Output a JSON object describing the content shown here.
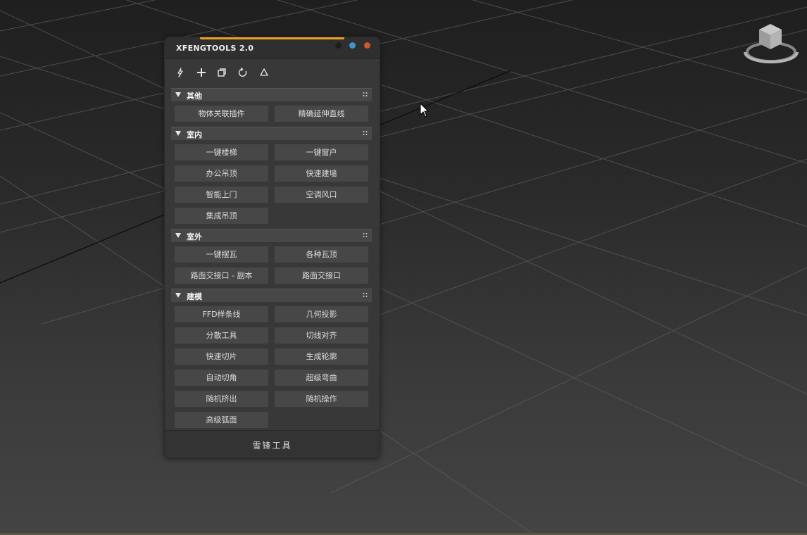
{
  "panel": {
    "title": "XFENGTOOLS  2.0",
    "accent_color": "#f0a020",
    "window_controls": {
      "minimize_color": "#1e1e1e",
      "maximize_color": "#3f95c8",
      "close_color": "#c85a2c"
    },
    "toolbar": {
      "icons": [
        "lightning-icon",
        "plus-icon",
        "copy-icon",
        "refresh-icon",
        "triangle-icon"
      ]
    },
    "sections": [
      {
        "title": "其他",
        "buttons": [
          "物体关联插件",
          "精确延伸直线"
        ]
      },
      {
        "title": "室内",
        "buttons": [
          "一键楼梯",
          "一键窗户",
          "办公吊顶",
          "快速建墙",
          "智能上门",
          "空调风口",
          "集成吊顶"
        ]
      },
      {
        "title": "室外",
        "buttons": [
          "一键摆瓦",
          "各种瓦顶",
          "路面交接口 - 副本",
          "路面交接口"
        ]
      },
      {
        "title": "建模",
        "buttons": [
          "FFD样条线",
          "几何投影",
          "分散工具",
          "切线对齐",
          "快速切片",
          "生成轮廓",
          "自动切角",
          "超级弯曲",
          "随机挤出",
          "随机操作",
          "高级弧面"
        ]
      }
    ],
    "footer": "雪锋工具"
  }
}
